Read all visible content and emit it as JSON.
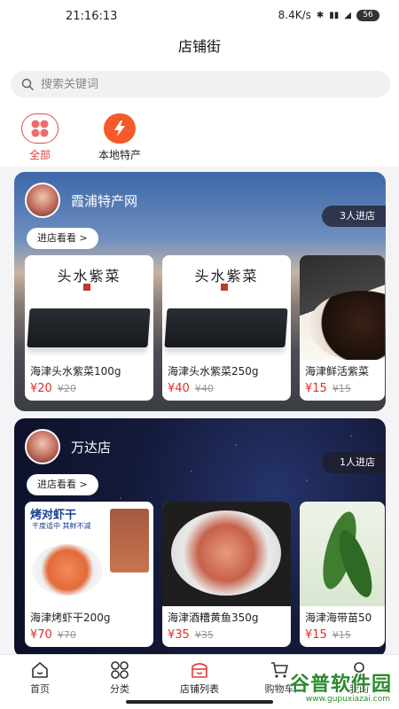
{
  "status_bar": {
    "time": "21:16:13",
    "net_speed": "8.4K/s",
    "battery": "56"
  },
  "header": {
    "title": "店铺街"
  },
  "search": {
    "placeholder": "搜索关键词"
  },
  "categories": [
    {
      "label": "全部",
      "icon": "grid-icon",
      "active": true
    },
    {
      "label": "本地特产",
      "icon": "lightning-icon",
      "active": false
    }
  ],
  "shops": [
    {
      "name": "霞浦特产网",
      "visitors": "3人进店",
      "enter_label": "进店看看 >",
      "products": [
        {
          "name": "海津头水紫菜100g",
          "price": "¥20",
          "orig_price": "¥20",
          "image_text": "头水紫菜"
        },
        {
          "name": "海津头水紫菜250g",
          "price": "¥40",
          "orig_price": "¥40",
          "image_text": "头水紫菜"
        },
        {
          "name": "海津鲜活紫菜",
          "price": "¥15",
          "orig_price": "¥15"
        }
      ]
    },
    {
      "name": "万达店",
      "visitors": "1人进店",
      "enter_label": "进店看看 >",
      "products": [
        {
          "name": "海津烤虾干200g",
          "price": "¥70",
          "orig_price": "¥70",
          "image_title": "烤对虾干",
          "image_sub": "干度适中 其鲜不减"
        },
        {
          "name": "海津酒糟黄鱼350g",
          "price": "¥35",
          "orig_price": "¥35"
        },
        {
          "name": "海津海带苗50",
          "price": "¥15",
          "orig_price": "¥15"
        }
      ]
    }
  ],
  "tabbar": [
    {
      "label": "首页",
      "icon": "home-icon"
    },
    {
      "label": "分类",
      "icon": "category-icon"
    },
    {
      "label": "店铺列表",
      "icon": "shop-icon",
      "active": true
    },
    {
      "label": "购物车",
      "icon": "cart-icon"
    },
    {
      "label": "我的",
      "icon": "user-icon"
    }
  ],
  "watermark": {
    "main": "谷普软件园",
    "url": "www.gupuxiazai.com"
  },
  "colors": {
    "accent": "#e23b3b",
    "price": "#e22d2d"
  }
}
